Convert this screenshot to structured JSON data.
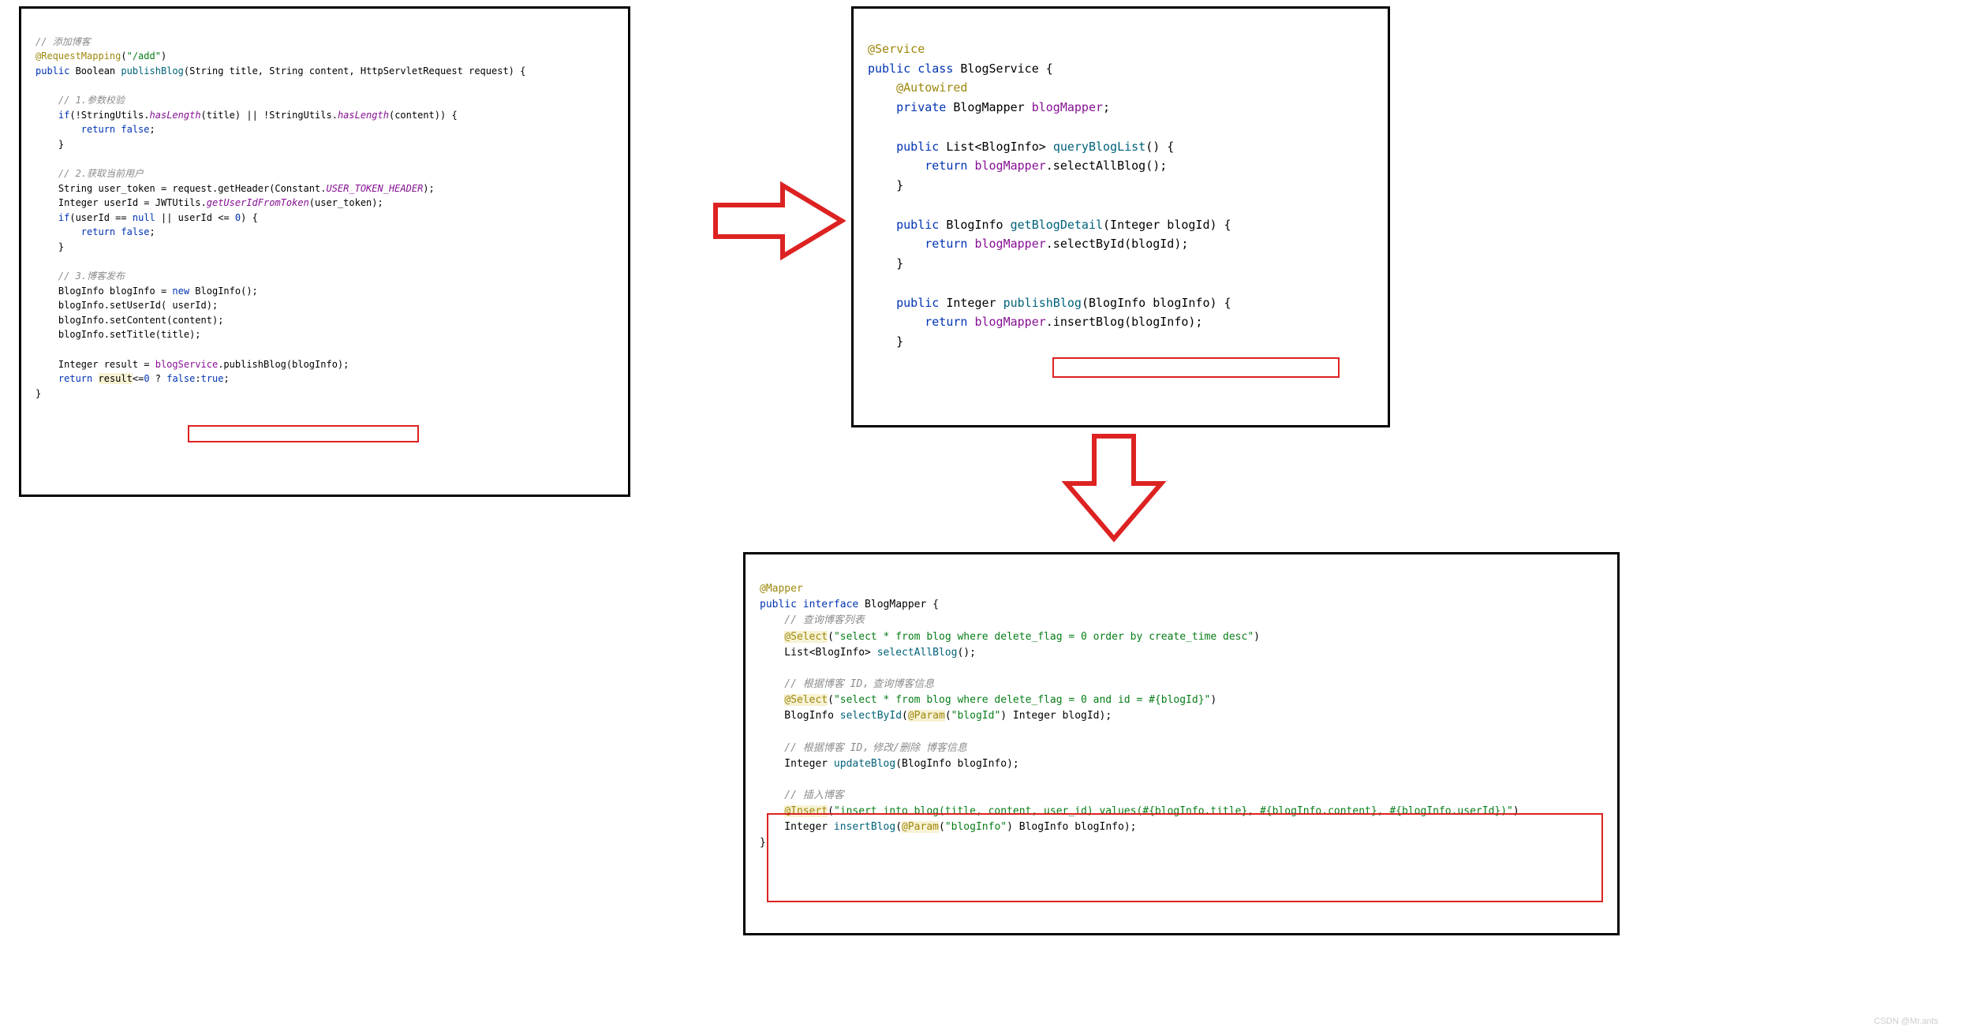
{
  "panel_left": {
    "c1": "// 添加博客",
    "l1a": "@RequestMapping",
    "l1b": "(",
    "l1c": "\"/add\"",
    "l1d": ")",
    "l2a": "public",
    "l2b": " Boolean ",
    "l2c": "publishBlog",
    "l2d": "(String title, String content, HttpServletRequest request) {",
    "c2": "    // 1.参数校验",
    "l3a": "    ",
    "l3b": "if",
    "l3c": "(!StringUtils.",
    "l3d": "hasLength",
    "l3e": "(title) || !StringUtils.",
    "l3f": "hasLength",
    "l3g": "(content)) {",
    "l4a": "        ",
    "l4b": "return false",
    "l4c": ";",
    "l5": "    }",
    "c3": "    // 2.获取当前用户",
    "l6a": "    String user_token = request.getHeader(Constant.",
    "l6b": "USER_TOKEN_HEADER",
    "l6c": ");",
    "l7a": "    Integer userId = JWTUtils.",
    "l7b": "getUserIdFromToken",
    "l7c": "(user_token);",
    "l8a": "    ",
    "l8b": "if",
    "l8c": "(userId == ",
    "l8d": "null",
    "l8e": " || userId <= ",
    "l8f": "0",
    "l8g": ") {",
    "l9a": "        ",
    "l9b": "return false",
    "l9c": ";",
    "l10": "    }",
    "c4": "    // 3.博客发布",
    "l11a": "    BlogInfo blogInfo = ",
    "l11b": "new",
    "l11c": " BlogInfo();",
    "l12": "    blogInfo.setUserId( userId);",
    "l13": "    blogInfo.setContent(content);",
    "l14": "    blogInfo.setTitle(title);",
    "l15a": "    Integer result = ",
    "l15b": "blogService",
    "l15c": ".publishBlog(blogInfo);",
    "l16a": "    ",
    "l16b": "return",
    "l16c": " ",
    "l16d": "result",
    "l16e": "<=",
    "l16f": "0",
    "l16g": " ? ",
    "l16h": "false",
    "l16i": ":",
    "l16j": "true",
    "l16k": ";",
    "l17": "}"
  },
  "panel_right": {
    "r1": "@Service",
    "r2a": "public class",
    "r2b": " BlogService {",
    "r3": "    @Autowired",
    "r4a": "    ",
    "r4b": "private",
    "r4c": " BlogMapper ",
    "r4d": "blogMapper",
    "r4e": ";",
    "r5a": "    ",
    "r5b": "public",
    "r5c": " List<BlogInfo> ",
    "r5d": "queryBlogList",
    "r5e": "() {",
    "r6a": "        ",
    "r6b": "return",
    "r6c": " ",
    "r6d": "blogMapper",
    "r6e": ".selectAllBlog();",
    "r7": "    }",
    "r8a": "    ",
    "r8b": "public",
    "r8c": " BlogInfo ",
    "r8d": "getBlogDetail",
    "r8e": "(Integer blogId) {",
    "r9a": "        ",
    "r9b": "return",
    "r9c": " ",
    "r9d": "blogMapper",
    "r9e": ".selectById(blogId);",
    "r10": "    }",
    "r11a": "    ",
    "r11b": "public",
    "r11c": " Integer ",
    "r11d": "publishBlog",
    "r11e": "(BlogInfo blogInfo) {",
    "r12a": "        ",
    "r12b": "return",
    "r12c": " ",
    "r12d": "blogMapper",
    "r12e": ".insertBlog(blogInfo);",
    "r13": "    }"
  },
  "panel_bottom": {
    "b1": "@Mapper",
    "b2a": "public interface",
    "b2b": " BlogMapper {",
    "bc1": "    // 查询博客列表",
    "b3a": "    ",
    "b3b": "@Select",
    "b3c": "(",
    "b3d": "\"select * from blog where delete_flag = 0 order by create_time desc\"",
    "b3e": ")",
    "b4a": "    List<BlogInfo> ",
    "b4b": "selectAllBlog",
    "b4c": "();",
    "bc2": "    // 根据博客 ID，查询博客信息",
    "b5a": "    ",
    "b5b": "@Select",
    "b5c": "(",
    "b5d": "\"select * from blog where delete_flag = 0 and id = #{blogId}\"",
    "b5e": ")",
    "b6a": "    BlogInfo ",
    "b6b": "selectById",
    "b6c": "(",
    "b6d": "@Param",
    "b6e": "(",
    "b6f": "\"blogId\"",
    "b6g": ") Integer blogId);",
    "bc3": "    // 根据博客 ID，修改/删除 博客信息",
    "b7a": "    Integer ",
    "b7b": "updateBlog",
    "b7c": "(BlogInfo blogInfo);",
    "bc4": "    // 插入博客",
    "b8a": "    ",
    "b8b": "@Insert",
    "b8c": "(",
    "b8d": "\"insert into blog(title, content, user_id) values(#{blogInfo.title}, #{blogInfo.content}, #{blogInfo.userId})\"",
    "b8e": ")",
    "b9a": "    Integer ",
    "b9b": "insertBlog",
    "b9c": "(",
    "b9d": "@Param",
    "b9e": "(",
    "b9f": "\"blogInfo\"",
    "b9g": ") BlogInfo blogInfo);",
    "b10": "}"
  },
  "watermark": "CSDN @Mr.ants"
}
